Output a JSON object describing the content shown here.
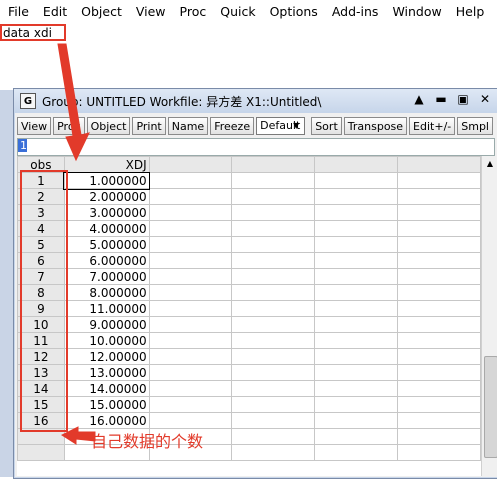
{
  "menu": [
    "File",
    "Edit",
    "Object",
    "View",
    "Proc",
    "Quick",
    "Options",
    "Add-ins",
    "Window",
    "Help"
  ],
  "command": "data xdi",
  "window": {
    "icon": "G",
    "title": "Group: UNTITLED   Workfile: 异方差 X1::Untitled\\",
    "buttons": [
      "▲",
      "▬",
      "▣",
      "✕"
    ]
  },
  "toolbar": {
    "buttons": [
      "View",
      "Proc",
      "Object",
      "Print",
      "Name",
      "Freeze"
    ],
    "dropdown": "Default",
    "buttons2": [
      "Sort",
      "Transpose",
      "Edit+/-",
      "Smpl"
    ]
  },
  "edit_value": "1",
  "grid": {
    "headers": [
      "obs",
      "XDJ"
    ],
    "rows": [
      [
        "1",
        "1.000000"
      ],
      [
        "2",
        "2.000000"
      ],
      [
        "3",
        "3.000000"
      ],
      [
        "4",
        "4.000000"
      ],
      [
        "5",
        "5.000000"
      ],
      [
        "6",
        "6.000000"
      ],
      [
        "7",
        "7.000000"
      ],
      [
        "8",
        "8.000000"
      ],
      [
        "9",
        "11.00000"
      ],
      [
        "10",
        "9.000000"
      ],
      [
        "11",
        "10.00000"
      ],
      [
        "12",
        "12.00000"
      ],
      [
        "13",
        "13.00000"
      ],
      [
        "14",
        "14.00000"
      ],
      [
        "15",
        "15.00000"
      ],
      [
        "16",
        "16.00000"
      ]
    ]
  },
  "annotation": "自己数据的个数",
  "colors": {
    "annotation": "#e23a2a"
  }
}
